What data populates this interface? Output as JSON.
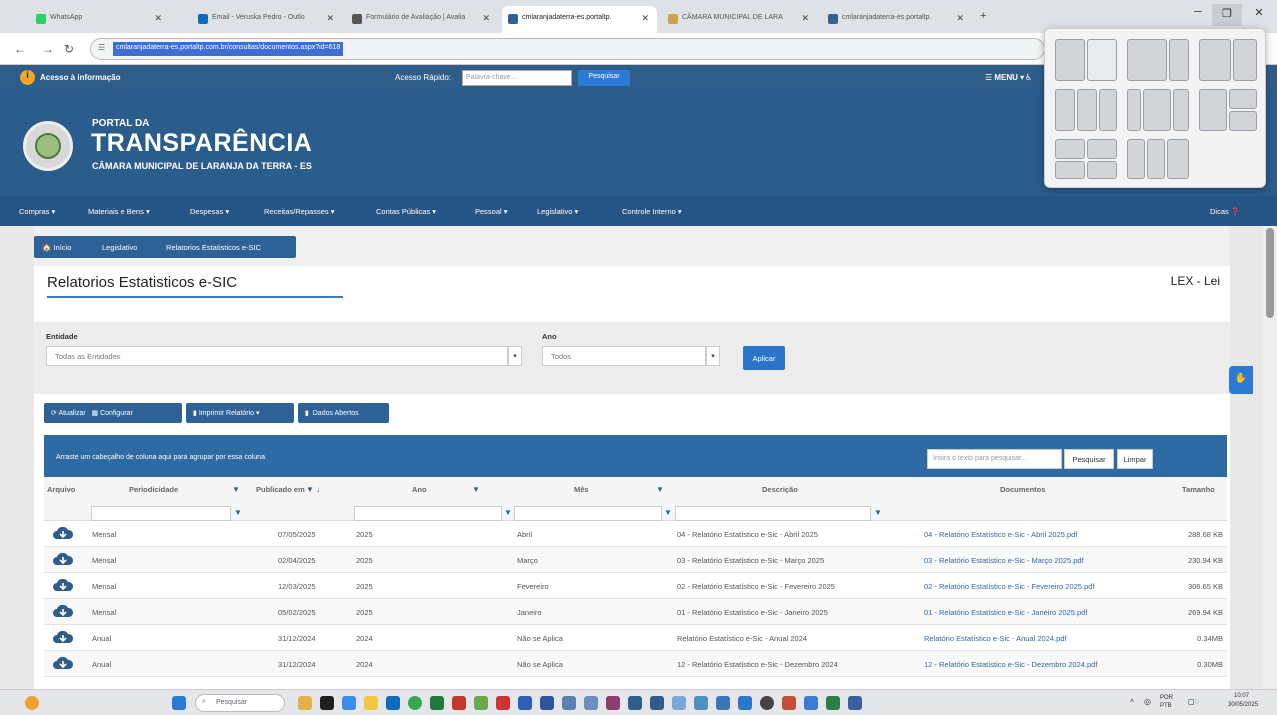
{
  "browser": {
    "tabs": [
      {
        "label": "WhatsApp",
        "color": "#25d366"
      },
      {
        "label": "Email - Veruska Pedro - Outlo",
        "color": "#0f6cbd"
      },
      {
        "label": "Formulário de Avaliação | Avalia",
        "color": "#555555"
      },
      {
        "label": "cmlaranjadaterra-es.portaltp.",
        "color": "#2e6296"
      },
      {
        "label": "CÂMARA MUNICIPAL DE LARA",
        "color": "#cfa14a"
      },
      {
        "label": "cmlaranjadaterra-es.portaltp.",
        "color": "#2e6296"
      }
    ],
    "new_tab": "+",
    "url": "cmlaranjadaterra-es.portaltp.com.br/consultas/documentos.aspx?id=618"
  },
  "topbar": {
    "info_label": "Acesso à informação",
    "quick_access_label": "Acesso Rápido:",
    "quick_placeholder": "Palavra-chave...",
    "search_button": "Pesquisar",
    "menu_label": "☰ MENU ▾"
  },
  "header": {
    "portal": "PORTAL DA",
    "transparencia": "TRANSPARÊNCIA",
    "camara": "CÂMARA MUNICIPAL DE LARANJA DA TERRA - ES"
  },
  "main_menu": {
    "items": [
      "Compras ▾",
      "Materiais e Bens ▾",
      "Despesas ▾",
      "Receitas/Repasses ▾",
      "Contas Públicas ▾",
      "Pessoal ▾",
      "Legislativo ▾",
      "Controle Interno ▾"
    ],
    "dicas": "Dicas"
  },
  "breadcrumb": {
    "home": "Início",
    "section": "Legislativo",
    "current": "Relatorios Estatisticos e-SIC"
  },
  "page": {
    "title": "Relatorios Estatisticos e-SIC",
    "lex": "LEX - Lei"
  },
  "filters": {
    "entidade_label": "Entidade",
    "entidade_value": "Todas as Entidades",
    "ano_label": "Ano",
    "ano_value": "Todos",
    "apply": "Aplicar"
  },
  "toolbar": {
    "atualizar": "Atualizar",
    "configurar": "Configurar",
    "imprimir": "Imprimir Relatório ▾",
    "dados": "Dados Abertos"
  },
  "grid": {
    "group_hint": "Arraste um cabeçalho de coluna aqui para agrupar por essa coluna",
    "search_placeholder": "Insira o texto para pesquisar...",
    "search_button": "Pesquisar",
    "clear_button": "Limpar",
    "columns": [
      "Arquivo",
      "Periodicidade",
      "Publicado em",
      "Ano",
      "Mês",
      "Descrição",
      "Documentos",
      "Tamanho"
    ],
    "rows": [
      {
        "periodicidade": "Mensal",
        "publicado": "07/05/2025",
        "ano": "2025",
        "mes": "Abril",
        "descricao": "04 - Relatório Estatístico e-Sic - Abril 2025",
        "documento": "04 - Relatório Estatístico e-Sic - Abril 2025.pdf",
        "tamanho": "288.68 KB"
      },
      {
        "periodicidade": "Mensal",
        "publicado": "02/04/2025",
        "ano": "2025",
        "mes": "Março",
        "descricao": "03 - Relatório Estatístico e-Sic - Março 2025",
        "documento": "03 - Relatório Estatístico e-Sic - Março 2025.pdf",
        "tamanho": "230.94 KB"
      },
      {
        "periodicidade": "Mensal",
        "publicado": "12/03/2025",
        "ano": "2025",
        "mes": "Fevereiro",
        "descricao": "02 - Relatório Estatístico e-Sic - Fevereiro 2025",
        "documento": "02 - Relatório Estatístico e-Sic - Fevereiro 2025.pdf",
        "tamanho": "306.65 KB"
      },
      {
        "periodicidade": "Mensal",
        "publicado": "05/02/2025",
        "ano": "2025",
        "mes": "Janeiro",
        "descricao": "01 - Relatório Estatístico e-Sic - Janeiro 2025",
        "documento": "01 - Relatório Estatístico e-Sic - Janeiro 2025.pdf",
        "tamanho": "269.94 KB"
      },
      {
        "periodicidade": "Anual",
        "publicado": "31/12/2024",
        "ano": "2024",
        "mes": "Não se Aplica",
        "descricao": "Relatório Estatístico e-Sic - Anual 2024",
        "documento": "Relatório Estatístico e-Sic - Anual 2024.pdf",
        "tamanho": "0.34MB"
      },
      {
        "periodicidade": "Anual",
        "publicado": "31/12/2024",
        "ano": "2024",
        "mes": "Não se Aplica",
        "descricao": "12 - Relatório Estatístico e-Sic - Dezembro 2024",
        "documento": "12 - Relatório Estatístico e-Sic - Dezembro 2024.pdf",
        "tamanho": "0.30MB"
      }
    ]
  },
  "taskbar": {
    "search": "Pesquisar",
    "lang": "POR PTB",
    "time": "10:07",
    "date": "30/05/2025"
  }
}
